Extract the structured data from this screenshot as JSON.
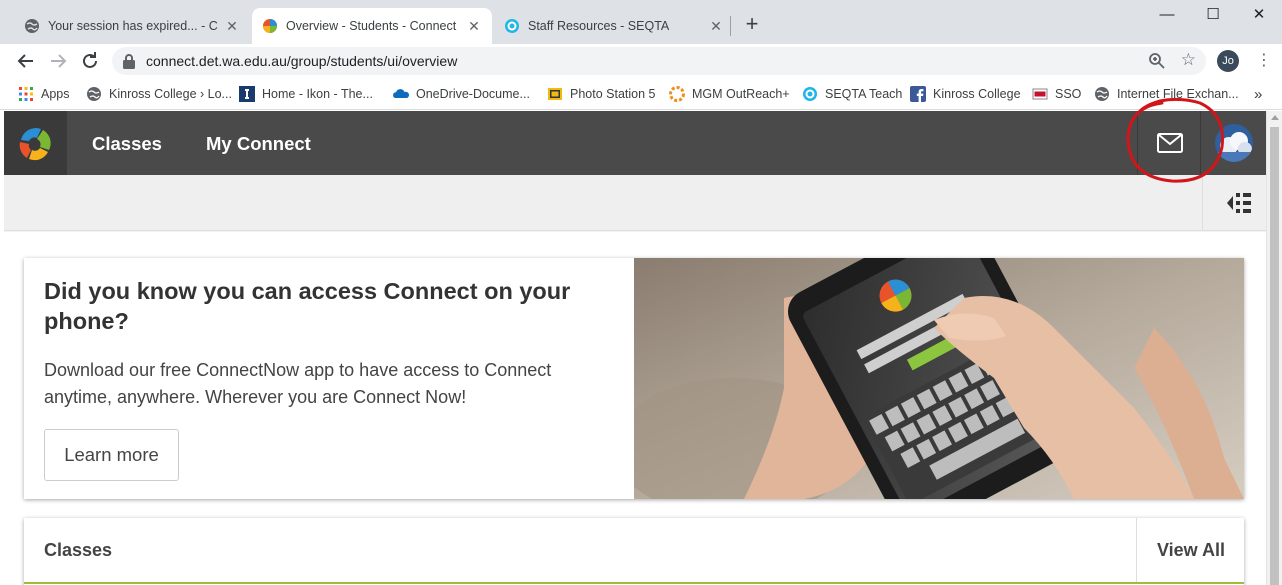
{
  "browser": {
    "tabs": [
      {
        "title": "Your session has expired... - Conn",
        "active": false
      },
      {
        "title": "Overview - Students - Connect",
        "active": true
      },
      {
        "title": "Staff Resources - SEQTA",
        "active": false
      }
    ],
    "new_tab_label": "+",
    "window_controls": {
      "minimize": "—",
      "maximize": "☐",
      "close": "✕"
    },
    "url": "connect.det.wa.edu.au/group/students/ui/overview",
    "profile_initials": "Jo",
    "bookmarks": [
      {
        "label": "Apps",
        "icon": "apps-grid-icon"
      },
      {
        "label": "Kinross College › Lo...",
        "icon": "globe-icon"
      },
      {
        "label": "Home - Ikon - The...",
        "icon": "ikon-icon"
      },
      {
        "label": "OneDrive-Docume...",
        "icon": "onedrive-icon"
      },
      {
        "label": "Photo Station 5",
        "icon": "photo-station-icon"
      },
      {
        "label": "MGM OutReach+",
        "icon": "mgm-icon"
      },
      {
        "label": "SEQTA Teach",
        "icon": "seqta-icon"
      },
      {
        "label": "Kinross College",
        "icon": "facebook-icon"
      },
      {
        "label": "SSO",
        "icon": "sso-icon"
      },
      {
        "label": "Internet File Exchan...",
        "icon": "globe-icon"
      }
    ],
    "bookmarks_overflow": "»"
  },
  "app": {
    "nav": [
      {
        "label": "Classes"
      },
      {
        "label": "My Connect"
      }
    ],
    "promo": {
      "heading": "Did you know you can access Connect on your phone?",
      "body": "Download our free ConnectNow app to have access to Connect anytime, anywhere. Wherever you are Connect Now!",
      "button": "Learn more"
    },
    "classes_card": {
      "title": "Classes",
      "view_all": "View All"
    }
  },
  "colors": {
    "appbar": "#4a4a4a",
    "accent_green": "#9cbf3b",
    "annotation_red": "#d0161a"
  }
}
